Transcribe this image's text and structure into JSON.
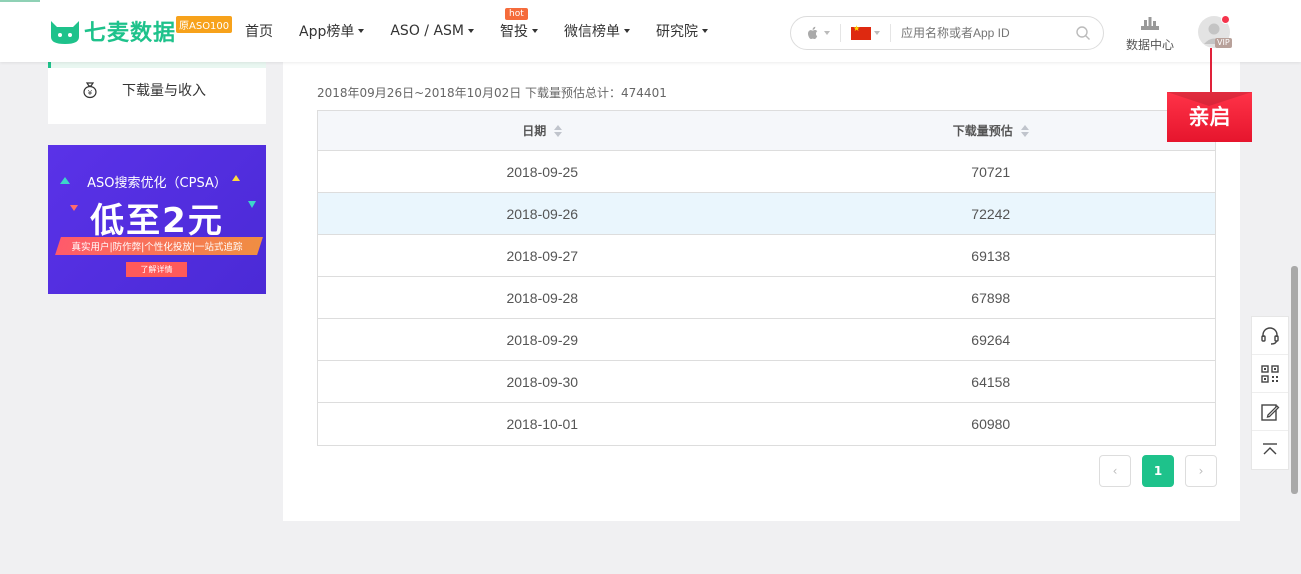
{
  "header": {
    "brand": "七麦数据",
    "brand_badge": "原ASO100",
    "nav": [
      {
        "label": "首页",
        "dropdown": false
      },
      {
        "label": "App榜单",
        "dropdown": true
      },
      {
        "label": "ASO / ASM",
        "dropdown": true
      },
      {
        "label": "智投",
        "dropdown": true,
        "badge": "hot"
      },
      {
        "label": "微信榜单",
        "dropdown": true
      },
      {
        "label": "研究院",
        "dropdown": true
      }
    ],
    "search_placeholder": "应用名称或者App ID",
    "data_center_label": "数据中心",
    "vip_label": "VIP"
  },
  "sidebar": {
    "active_item": "下载量与收入"
  },
  "banner": {
    "title": "ASO搜索优化（CPSA）",
    "headline": "低至2元",
    "strip": "真实用户|防作弊|个性化投放|一站式追踪",
    "button": "了解详情"
  },
  "main": {
    "summary": "2018年09月26日~2018年10月02日 下载量预估总计：474401",
    "columns": [
      "日期",
      "下载量预估"
    ],
    "rows": [
      {
        "date": "2018-09-25",
        "downloads": "70721"
      },
      {
        "date": "2018-09-26",
        "downloads": "72242"
      },
      {
        "date": "2018-09-27",
        "downloads": "69138"
      },
      {
        "date": "2018-09-28",
        "downloads": "67898"
      },
      {
        "date": "2018-09-29",
        "downloads": "69264"
      },
      {
        "date": "2018-09-30",
        "downloads": "64158"
      },
      {
        "date": "2018-10-01",
        "downloads": "60980"
      }
    ],
    "highlighted_row": 1,
    "current_page": "1",
    "prev_label": "‹",
    "next_label": "›"
  },
  "promo_ribbon": "亲启",
  "colors": {
    "brand_green": "#1ec28b",
    "banner_purple": "#5a32e8",
    "ribbon_red": "#e6152d"
  }
}
